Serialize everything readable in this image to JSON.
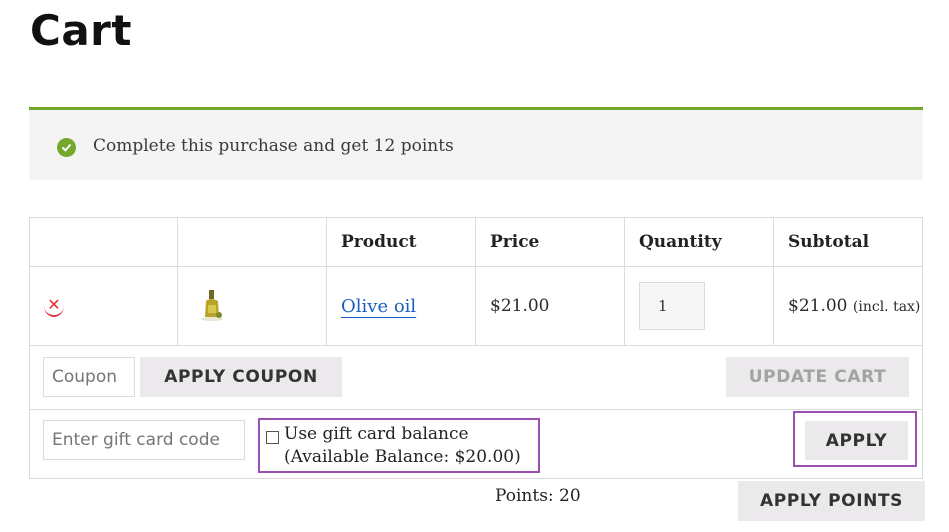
{
  "page": {
    "title": "Cart"
  },
  "notice": {
    "message": "Complete this purchase and get 12 points",
    "icon": "check-circle-icon",
    "accent": "#74a82d"
  },
  "table": {
    "headers": [
      "",
      "",
      "Product",
      "Price",
      "Quantity",
      "Subtotal"
    ],
    "rows": [
      {
        "remove_icon": "remove-x-icon",
        "thumbnail_icon": "olive-oil-bottle-icon",
        "product": "Olive oil",
        "price": "$21.00",
        "quantity": "1",
        "subtotal": "$21.00",
        "subtotal_note": "(incl. tax)"
      }
    ]
  },
  "coupon": {
    "placeholder": "Coupon",
    "apply_label": "APPLY COUPON",
    "update_label": "UPDATE CART"
  },
  "gift_card": {
    "placeholder": "Enter gift card code",
    "balance_label_line1": "Use gift card balance",
    "balance_label_line2": "(Available Balance: $20.00)",
    "apply_label": "APPLY"
  },
  "points": {
    "text": "Points: 20",
    "apply_label": "APPLY POINTS"
  },
  "colors": {
    "link": "#1a5ec2",
    "remove": "#e0303a",
    "highlight": "#9b4fb3",
    "button_bg": "#ebe9eb"
  }
}
